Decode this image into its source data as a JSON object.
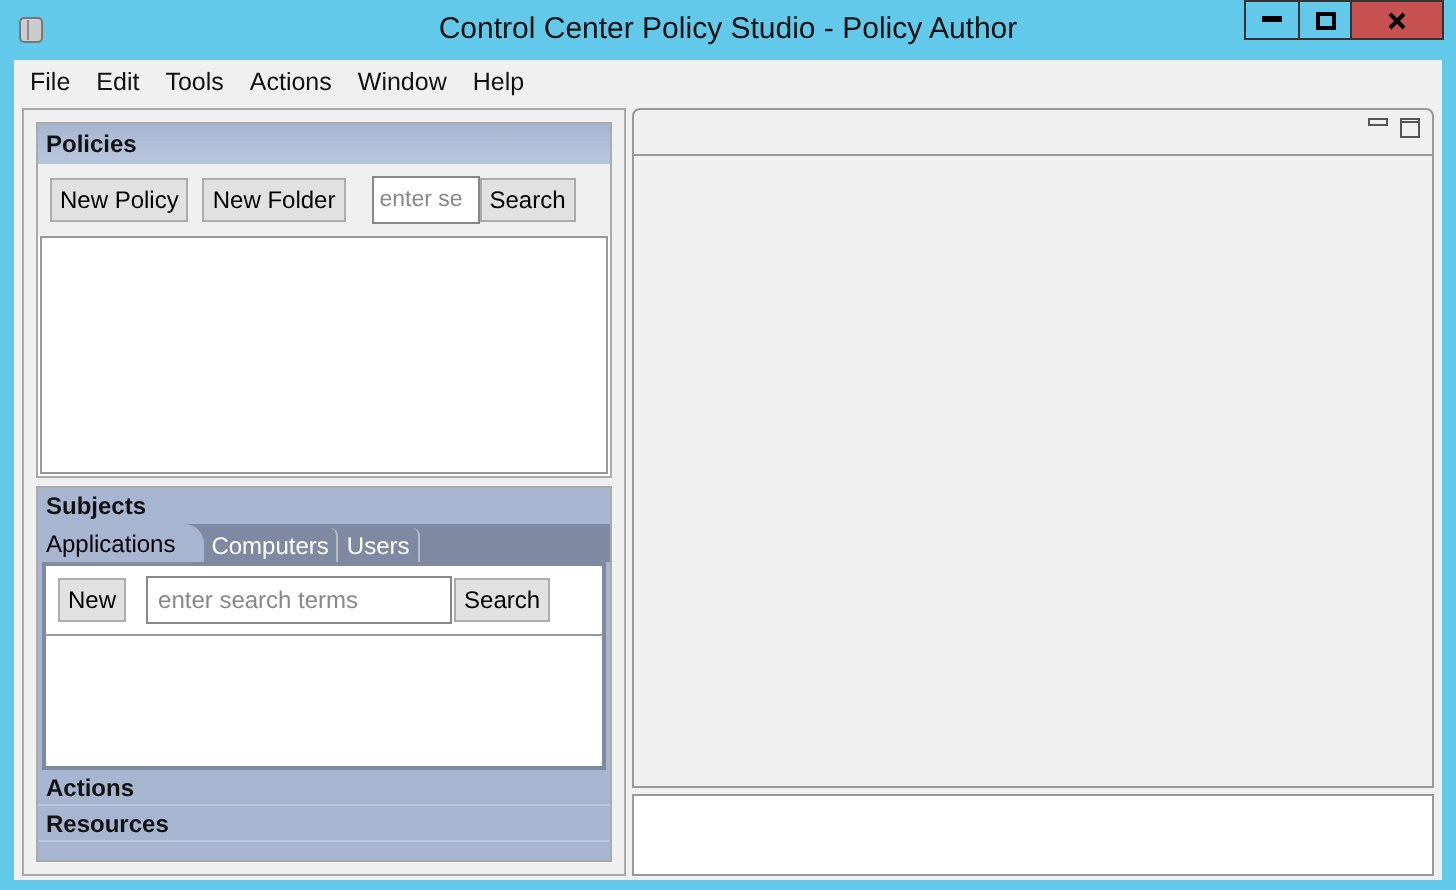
{
  "window": {
    "title": "Control Center Policy Studio - Policy Author"
  },
  "menu": [
    "File",
    "Edit",
    "Tools",
    "Actions",
    "Window",
    "Help"
  ],
  "policies": {
    "title": "Policies",
    "buttons": [
      "New Policy",
      "New Folder"
    ],
    "search": {
      "placeholder": "enter se"
    },
    "search_button": "Search"
  },
  "subjects": {
    "title": "Subjects",
    "tabs": [
      {
        "label": "Applications",
        "selected": true
      },
      {
        "label": "Computers",
        "selected": false
      },
      {
        "label": "Users",
        "selected": false
      }
    ],
    "new_button": "New",
    "search": {
      "placeholder": "enter search terms"
    },
    "search_button": "Search"
  },
  "sections": [
    "Actions",
    "Resources"
  ]
}
